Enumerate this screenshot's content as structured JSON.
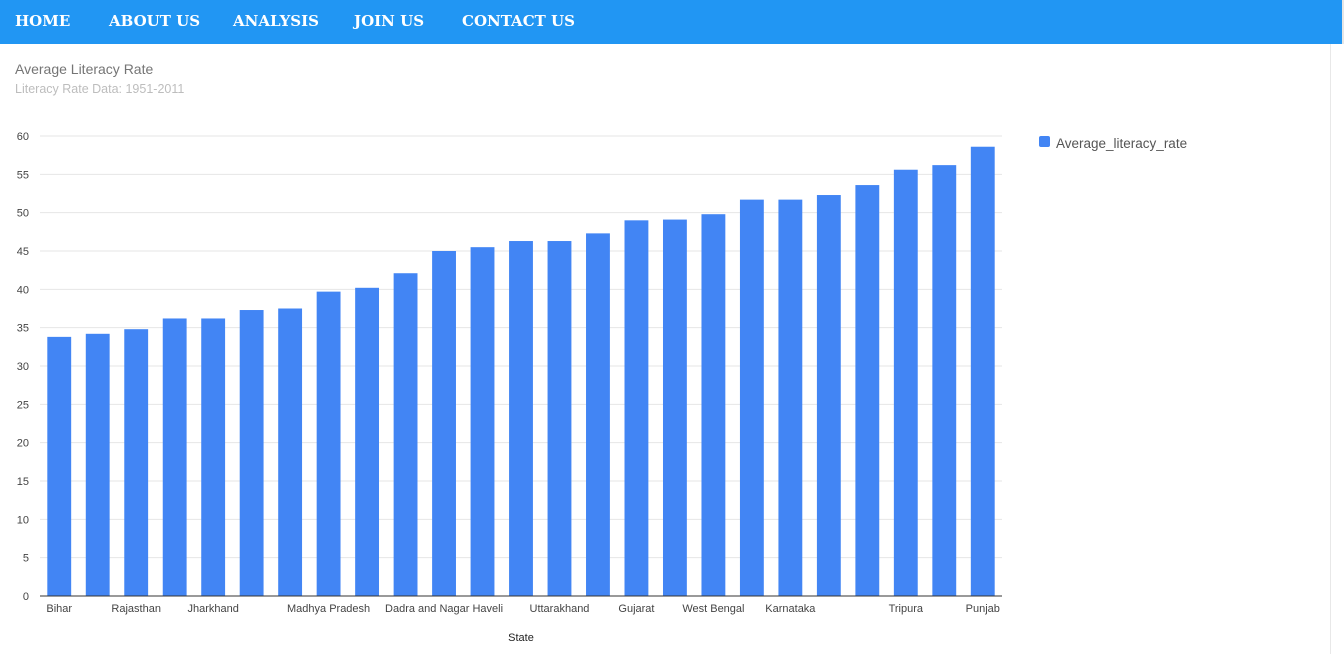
{
  "nav": {
    "items": [
      {
        "label": "HOME"
      },
      {
        "label": "ABOUT US"
      },
      {
        "label": "ANALYSIS"
      },
      {
        "label": "JOIN US"
      },
      {
        "label": "CONTACT US"
      }
    ]
  },
  "colors": {
    "nav_background": "#2196f3",
    "bar": "#4285f4",
    "gridline": "#e6e6e6"
  },
  "chart_data": {
    "type": "bar",
    "title": "Average Literacy Rate",
    "subtitle": "Literacy Rate Data: 1951-2011",
    "xlabel": "State",
    "ylabel": "",
    "ylim": [
      0,
      60
    ],
    "yticks": [
      0,
      5,
      10,
      15,
      20,
      25,
      30,
      35,
      40,
      45,
      50,
      55,
      60
    ],
    "grid": true,
    "legend_position": "right",
    "categories": [
      "Bihar",
      "",
      "Rajasthan",
      "",
      "Jharkhand",
      "",
      "",
      "Madhya Pradesh",
      "",
      "",
      "Dadra and Nagar Haveli",
      "",
      "",
      "Uttarakhand",
      "",
      "Gujarat",
      "",
      "West Bengal",
      "",
      "Karnataka",
      "",
      "",
      "Tripura",
      "",
      "Punjab",
      ""
    ],
    "series": [
      {
        "name": "Average_literacy_rate",
        "values": [
          33.8,
          34.2,
          34.8,
          36.2,
          36.2,
          37.3,
          37.5,
          39.7,
          40.2,
          42.1,
          45.0,
          45.5,
          46.3,
          46.3,
          47.3,
          49.0,
          49.1,
          49.8,
          51.7,
          51.7,
          52.3,
          53.6,
          55.6,
          56.2,
          58.6
        ]
      }
    ]
  }
}
